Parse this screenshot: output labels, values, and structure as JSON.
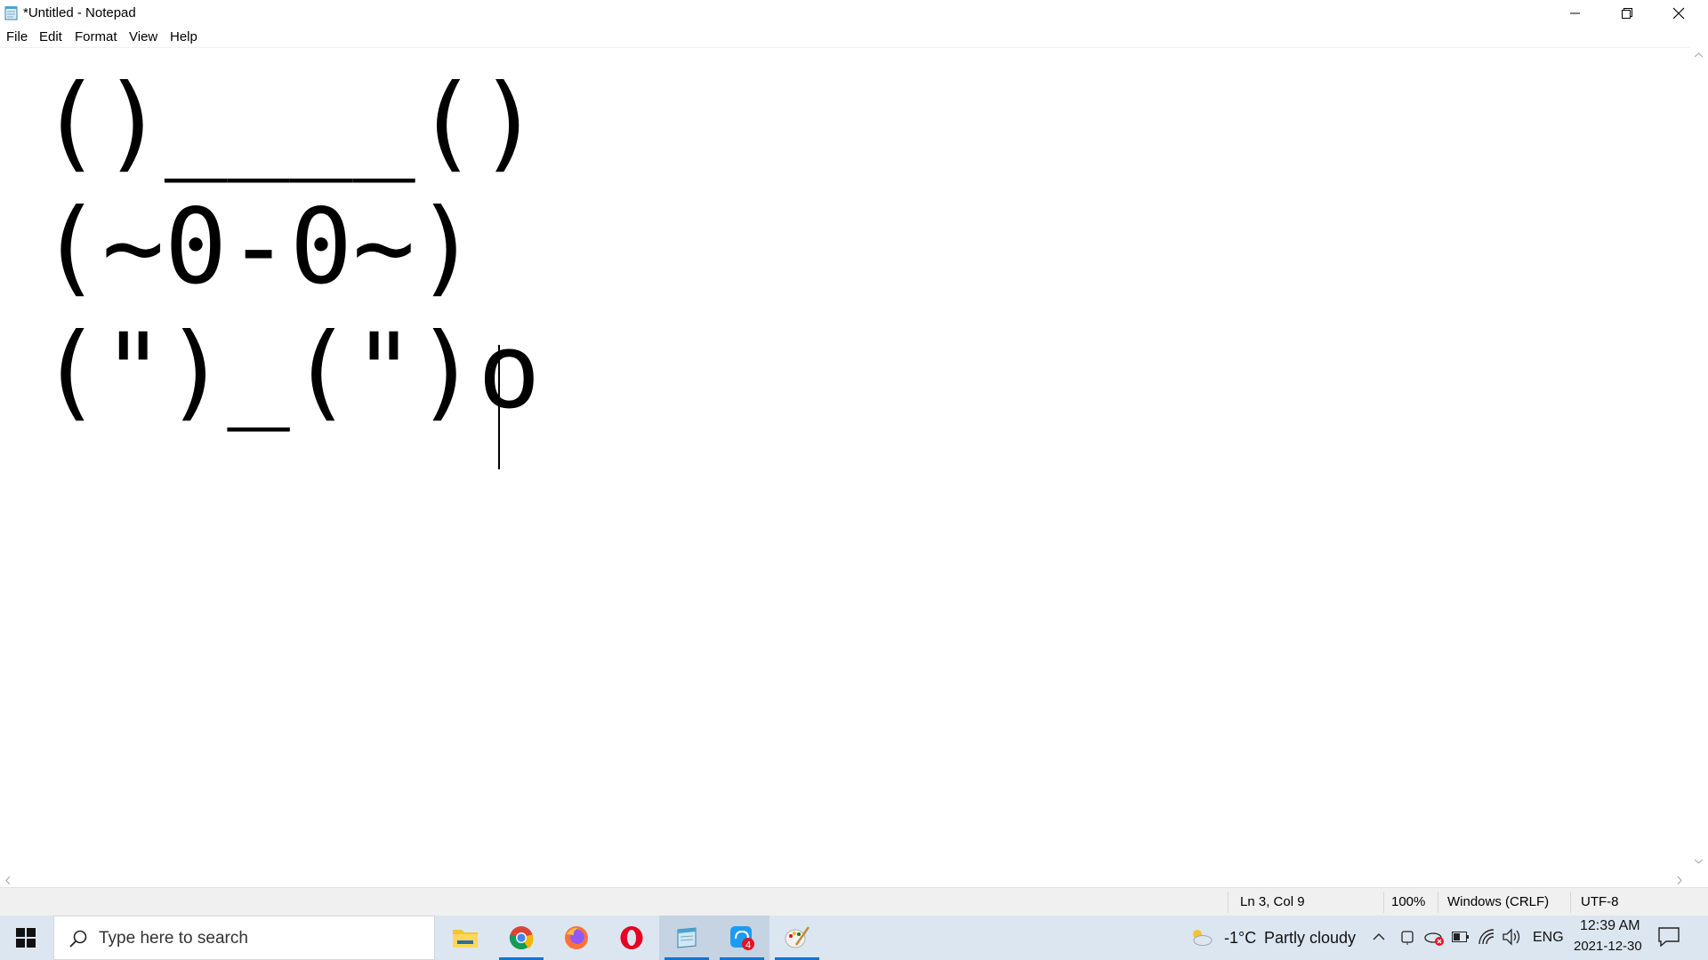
{
  "window": {
    "title": "*Untitled - Notepad"
  },
  "menu": [
    "File",
    "Edit",
    "Format",
    "View",
    "Help"
  ],
  "editor": {
    "lines": [
      "()____()",
      "(~0-0~)",
      "(\")_(\")o"
    ]
  },
  "status": {
    "position": "Ln 3, Col 9",
    "zoom": "100%",
    "line_endings": "Windows (CRLF)",
    "encoding": "UTF-8"
  },
  "taskbar": {
    "search_placeholder": "Type here to search",
    "apps": [
      "file-explorer",
      "chrome",
      "firefox",
      "opera",
      "notepad",
      "messaging",
      "paint"
    ],
    "badge_count": "4",
    "weather_temp": "-1°C",
    "weather_text": "Partly cloudy",
    "language": "ENG",
    "time": "12:39 AM",
    "date": "2021-12-30"
  },
  "colors": {
    "taskbar": "#dce6f0",
    "accent": "#1a73c9",
    "statusbar": "#f0f0f0"
  }
}
